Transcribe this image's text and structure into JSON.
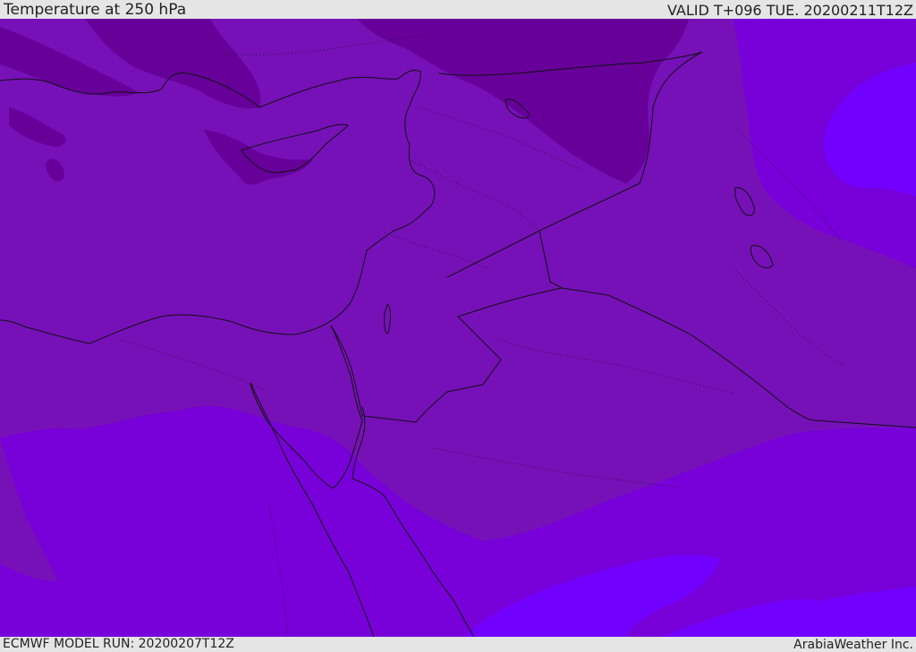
{
  "header": {
    "title": "Temperature at 250 hPa",
    "valid": "VALID T+096 TUE. 20200211T12Z"
  },
  "footer": {
    "model_run": "ECMWF MODEL RUN: 20200207T12Z",
    "brand": "ArabiaWeather Inc."
  },
  "colors": {
    "zone_mid": "#7611b8",
    "zone_cold": "#660099",
    "zone_warm": "#7800d8",
    "zone_warmest": "#7200ff",
    "borders": "#111111",
    "bars": "#e5e5e5"
  }
}
